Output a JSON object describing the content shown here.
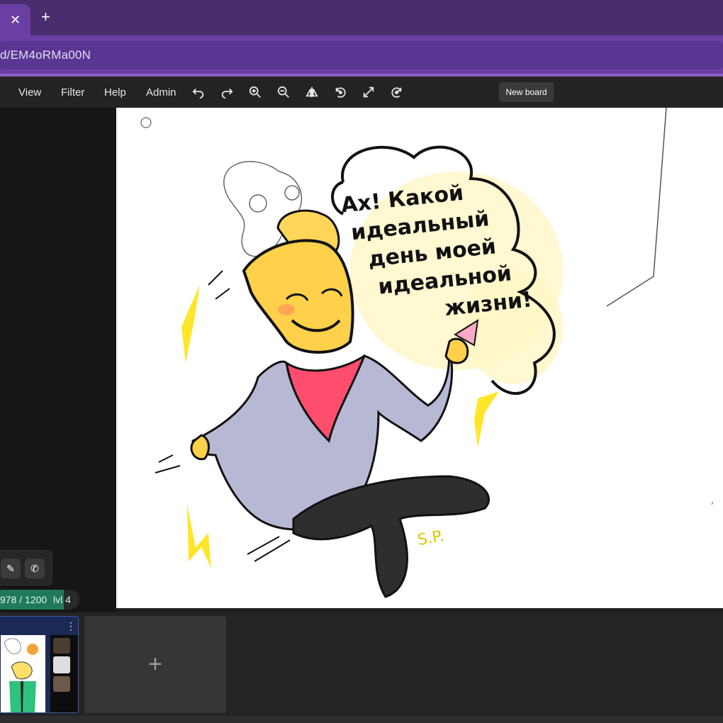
{
  "browser": {
    "tab_close": "✕",
    "tab_new": "+",
    "address": "d/EM4oRMa00N"
  },
  "toolbar": {
    "menus": [
      "View",
      "Filter",
      "Help",
      "Admin"
    ],
    "new_board": "New board"
  },
  "drawing": {
    "speech_lines": [
      "Ах! Какой",
      "идеальный",
      "день моей",
      "идеальной",
      "жизни!"
    ],
    "signature": "S.P."
  },
  "progress": {
    "text": "978 / 1200",
    "current": 978,
    "max": 1200,
    "level": "lvl 4"
  },
  "boards": {
    "add": "+"
  },
  "colors": {
    "tab_bar": "#4a2d6e",
    "address_bar": "#6a3fa3",
    "xp_fill": "#1e7a5a"
  }
}
